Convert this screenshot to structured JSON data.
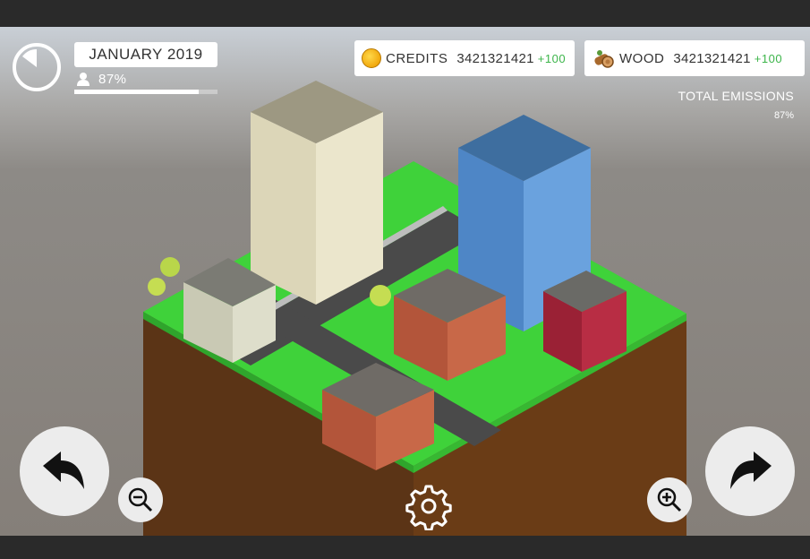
{
  "hud": {
    "date": "JANUARY 2019",
    "population_percent": "87%",
    "population_fraction": 0.87,
    "credits": {
      "icon": "coin-icon",
      "label": "CREDITS",
      "value": "3421321421",
      "delta": "+100"
    },
    "wood": {
      "icon": "wood-logs-icon",
      "label": "WOOD",
      "value": "3421321421",
      "delta": "+100"
    },
    "emissions": {
      "label": "TOTAL EMISSIONS",
      "value": "87%"
    },
    "clock_icon": "timer-clock-icon"
  },
  "controls": {
    "undo": "undo-arrow-icon",
    "redo": "redo-arrow-icon",
    "zoom_out": "zoom-out-icon",
    "zoom_in": "zoom-in-icon",
    "settings": "gear-icon"
  },
  "colors": {
    "grass": "#3fd23a",
    "soil_left": "#5b3416",
    "soil_right": "#6a3c16",
    "delta_green": "#3cb54a",
    "tower_beige": "#e6e1c6",
    "tower_blue": "#5d95d4"
  }
}
